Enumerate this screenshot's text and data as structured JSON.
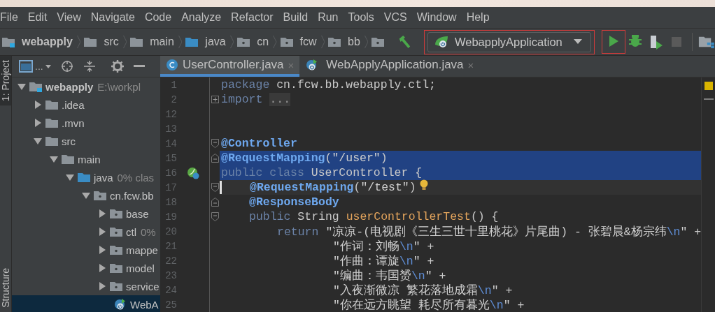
{
  "menu": [
    "File",
    "Edit",
    "View",
    "Navigate",
    "Code",
    "Analyze",
    "Refactor",
    "Build",
    "Run",
    "Tools",
    "VCS",
    "Window",
    "Help"
  ],
  "breadcrumbs": [
    {
      "label": "webapply",
      "kind": "module"
    },
    {
      "label": "src",
      "kind": "folder"
    },
    {
      "label": "main",
      "kind": "folder"
    },
    {
      "label": "java",
      "kind": "source"
    },
    {
      "label": "cn",
      "kind": "package"
    },
    {
      "label": "fcw",
      "kind": "package"
    },
    {
      "label": "bb",
      "kind": "package"
    },
    {
      "kind": "package"
    }
  ],
  "run_config": {
    "label": "WebapplyApplication"
  },
  "toolbar": [
    {
      "kind": "run",
      "disabled": false
    },
    {
      "kind": "debug",
      "disabled": false
    },
    {
      "kind": "coverage",
      "disabled": false
    },
    {
      "kind": "stop",
      "disabled": true
    }
  ],
  "side_tabs": [
    {
      "label": "1: Project",
      "selected": true
    },
    {
      "label": "Structure",
      "selected": false
    }
  ],
  "tabs": [
    {
      "label": "UserController.java",
      "kind": "class",
      "selected": true
    },
    {
      "label": "WebApplyApplication.java",
      "kind": "app",
      "selected": false
    }
  ],
  "close_glyph": "×",
  "view_menu": "...",
  "code": [
    {
      "number": "1",
      "kind": "top",
      "selected": false,
      "tokens": [
        {
          "kind": "kw",
          "t": "package"
        },
        {
          "kind": "plain",
          "t": " cn.fcw.bb.webapply.ctl;"
        }
      ]
    },
    {
      "number": "2",
      "kind": "top",
      "selected": false,
      "fold": {
        "kind": "collapsed"
      },
      "tokens": [
        {
          "kind": "kw",
          "t": "import"
        },
        {
          "kind": "folded",
          "t": "..."
        }
      ]
    },
    {
      "number": "12",
      "selected": false
    },
    {
      "number": "13",
      "selected": false
    },
    {
      "number": "14",
      "kind": "top",
      "selected": false,
      "fold": {
        "kind": "start"
      },
      "tokens": [
        {
          "kind": "ann",
          "t": "@Controller"
        }
      ]
    },
    {
      "number": "15",
      "kind": "top",
      "selected": true,
      "fold": {
        "kind": "end"
      },
      "tokens": [
        {
          "kind": "ann",
          "t": "@RequestMapping"
        },
        {
          "kind": "plain",
          "t": "("
        },
        {
          "kind": "str",
          "t": "\"/user\""
        },
        {
          "kind": "plain",
          "t": ")"
        }
      ]
    },
    {
      "number": "16",
      "kind": "top",
      "selected": true,
      "marker": {
        "kind": "bean"
      },
      "tokens": [
        {
          "kind": "kw",
          "t": "public class"
        },
        {
          "kind": "plain",
          "t": " UserController {"
        }
      ]
    },
    {
      "number": "17",
      "kind": "member",
      "selected": false,
      "fold": {
        "kind": "start"
      },
      "caret": true,
      "bulb": true,
      "tokens": [
        {
          "kind": "ann",
          "t": "@RequestMapping"
        },
        {
          "kind": "plain",
          "t": "("
        },
        {
          "kind": "str",
          "t": "\"/test\""
        },
        {
          "kind": "plain",
          "t": ")"
        }
      ]
    },
    {
      "number": "18",
      "kind": "member",
      "selected": false,
      "fold": {
        "kind": "end"
      },
      "tokens": [
        {
          "kind": "ann",
          "t": "@ResponseBody"
        }
      ]
    },
    {
      "number": "19",
      "kind": "member",
      "selected": false,
      "fold": {
        "kind": "start"
      },
      "tokens": [
        {
          "kind": "kw",
          "t": "public"
        },
        {
          "kind": "plain",
          "t": " String "
        },
        {
          "kind": "method",
          "t": "userControllerTest"
        },
        {
          "kind": "plain",
          "t": "() {"
        }
      ]
    },
    {
      "number": "20",
      "kind": "statement",
      "selected": false,
      "tokens": [
        {
          "kind": "kw",
          "t": "return"
        },
        {
          "kind": "str",
          "t": "\"凉凉-(电视剧《三生三世十里桃花》片尾曲) - 张碧晨&杨宗纬"
        },
        {
          "kind": "esc",
          "t": "\\n"
        },
        {
          "kind": "str",
          "t": "\""
        },
        {
          "kind": "plain",
          "t": " +"
        }
      ]
    },
    {
      "number": "21",
      "kind": "continuation",
      "selected": false,
      "tokens": [
        {
          "kind": "str",
          "t": "\"作词：刘畅"
        },
        {
          "kind": "esc",
          "t": "\\n"
        },
        {
          "kind": "str",
          "t": "\""
        },
        {
          "kind": "plain",
          "t": " +"
        }
      ]
    },
    {
      "number": "22",
      "kind": "continuation",
      "selected": false,
      "tokens": [
        {
          "kind": "str",
          "t": "\"作曲：谭旋"
        },
        {
          "kind": "esc",
          "t": "\\n"
        },
        {
          "kind": "str",
          "t": "\""
        },
        {
          "kind": "plain",
          "t": " +"
        }
      ]
    },
    {
      "number": "23",
      "kind": "continuation",
      "selected": false,
      "tokens": [
        {
          "kind": "str",
          "t": "\"编曲：韦国赟"
        },
        {
          "kind": "esc",
          "t": "\\n"
        },
        {
          "kind": "str",
          "t": "\""
        },
        {
          "kind": "plain",
          "t": " +"
        }
      ]
    },
    {
      "number": "24",
      "kind": "continuation",
      "selected": false,
      "tokens": [
        {
          "kind": "str",
          "t": "\"入夜渐微凉 繁花落地成霜"
        },
        {
          "kind": "esc",
          "t": "\\n"
        },
        {
          "kind": "str",
          "t": "\""
        },
        {
          "kind": "plain",
          "t": " +"
        }
      ]
    },
    {
      "number": "25",
      "kind": "continuation",
      "selected": false,
      "tokens": [
        {
          "kind": "str",
          "t": "\"你在远方眺望 耗尽所有暮光"
        },
        {
          "kind": "esc",
          "t": "\\n"
        },
        {
          "kind": "str",
          "t": "\""
        },
        {
          "kind": "plain",
          "t": " +"
        }
      ]
    }
  ],
  "tree": [
    {
      "label": "webapply",
      "hint": "E:\\workpl",
      "kind": "module",
      "expanded": true,
      "selected": false,
      "children": [
        {
          "label": ".idea",
          "kind": "folder",
          "expanded": false,
          "selected": false
        },
        {
          "label": ".mvn",
          "kind": "folder",
          "expanded": false,
          "selected": false
        },
        {
          "label": "src",
          "kind": "folder",
          "expanded": true,
          "selected": false,
          "children": [
            {
              "label": "main",
              "kind": "folder",
              "expanded": true,
              "selected": false,
              "children": [
                {
                  "label": "java",
                  "hint": "0% clas",
                  "kind": "source",
                  "expanded": true,
                  "selected": false,
                  "children": [
                    {
                      "label": "cn.fcw.bb",
                      "kind": "package",
                      "expanded": true,
                      "selected": false,
                      "children": [
                        {
                          "label": "base",
                          "kind": "package",
                          "expanded": false,
                          "selected": false
                        },
                        {
                          "label": "ctl",
                          "hint": "0%",
                          "kind": "package",
                          "expanded": false,
                          "selected": false
                        },
                        {
                          "label": "mappe",
                          "kind": "package",
                          "expanded": false,
                          "selected": false
                        },
                        {
                          "label": "model",
                          "kind": "package",
                          "expanded": false,
                          "selected": false
                        },
                        {
                          "label": "service",
                          "kind": "package",
                          "expanded": false,
                          "selected": false
                        },
                        {
                          "label": "WebA",
                          "kind": "app",
                          "selected": true
                        }
                      ]
                    }
                  ]
                }
              ]
            }
          ]
        }
      ]
    }
  ]
}
